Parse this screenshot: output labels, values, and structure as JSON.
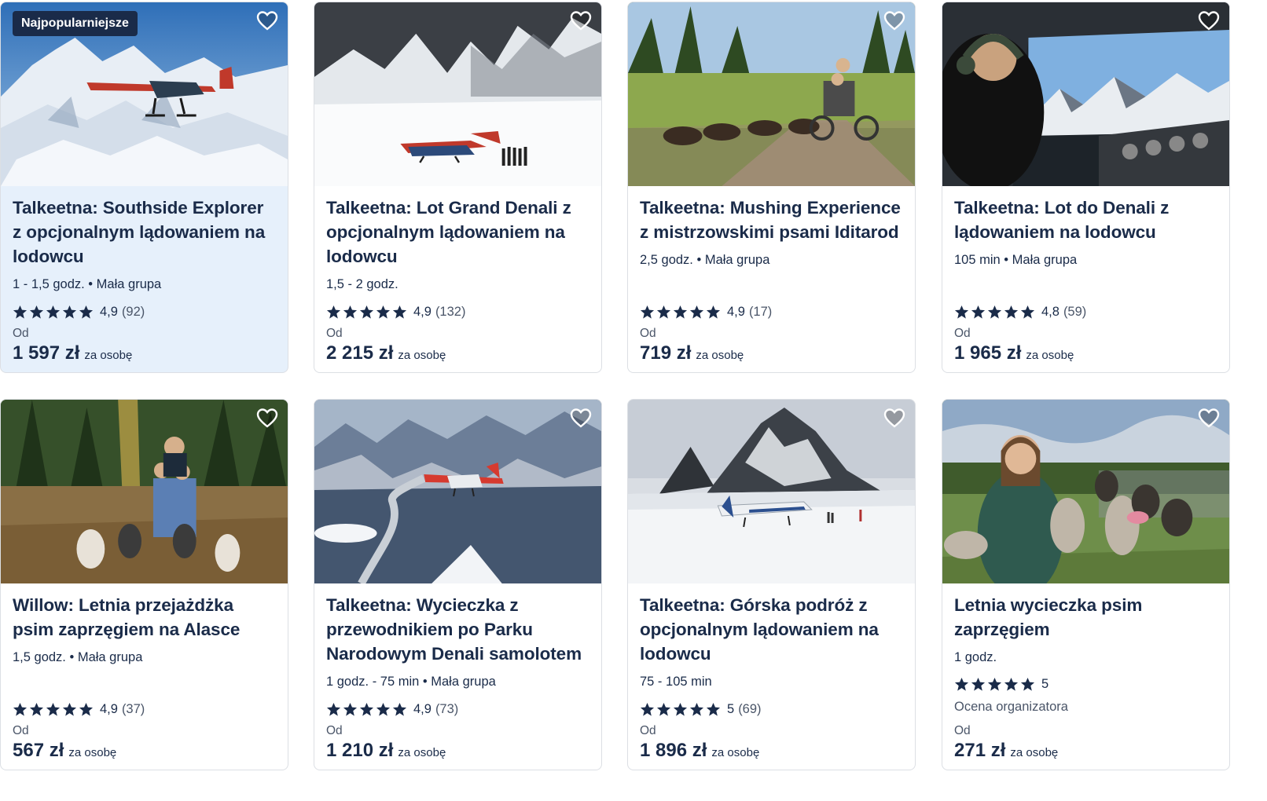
{
  "cards": [
    {
      "badge": "Najpopularniejsze",
      "title": "Talkeetna: Southside Explorer z opcjonalnym lądowaniem na lodowcu",
      "meta": "1 - 1,5 godz. • Mała grupa",
      "rating": "4,9",
      "count": "(92)",
      "from": "Od",
      "price": "1 597 zł",
      "per": "za osobę",
      "image": "mountain-plane-flight",
      "featured": true
    },
    {
      "title": "Talkeetna: Lot Grand Denali z opcjonalnym lądowaniem na lodowcu",
      "meta": "1,5 - 2 godz.",
      "rating": "4,9",
      "count": "(132)",
      "from": "Od",
      "price": "2 215 zł",
      "per": "za osobę",
      "image": "plane-on-glacier"
    },
    {
      "title": "Talkeetna: Mushing Experience z mistrzowskimi psami Iditarod",
      "meta": "2,5 godz. • Mała grupa",
      "rating": "4,9",
      "count": "(17)",
      "from": "Od",
      "price": "719 zł",
      "per": "za osobę",
      "image": "dog-cart-forest"
    },
    {
      "title": "Talkeetna: Lot do Denali z lądowaniem na lodowcu",
      "meta": "105 min • Mała grupa",
      "rating": "4,8",
      "count": "(59)",
      "from": "Od",
      "price": "1 965 zł",
      "per": "za osobę",
      "image": "cockpit-pilot"
    },
    {
      "title": "Willow: Letnia przejażdżka psim zaprzęgiem na Alasce",
      "meta": "1,5 godz. • Mała grupa",
      "rating": "4,9",
      "count": "(37)",
      "from": "Od",
      "price": "567 zł",
      "per": "za osobę",
      "image": "dog-sled-autumn"
    },
    {
      "title": "Talkeetna: Wycieczka z przewodnikiem po Parku Narodowym Denali samolotem",
      "meta": "1 godz. - 75 min • Mała grupa",
      "rating": "4,9",
      "count": "(73)",
      "from": "Od",
      "price": "1 210 zł",
      "per": "za osobę",
      "image": "plane-over-valley"
    },
    {
      "title": "Talkeetna: Górska podróż z opcjonalnym lądowaniem na lodowcu",
      "meta": "75 - 105 min",
      "rating": "5",
      "count": "(69)",
      "from": "Od",
      "price": "1 896 zł",
      "per": "za osobę",
      "image": "plane-below-peak"
    },
    {
      "title": "Letnia wycieczka psim zaprzęgiem",
      "meta": "1 godz.",
      "rating": "5",
      "count": "",
      "organizer": "Ocena organizatora",
      "from": "Od",
      "price": "271 zł",
      "per": "za osobę",
      "image": "woman-with-huskies"
    }
  ],
  "colors": {
    "navy": "#1a2b49",
    "featured_bg": "#e6f0fb",
    "border": "#dcdfe4"
  }
}
